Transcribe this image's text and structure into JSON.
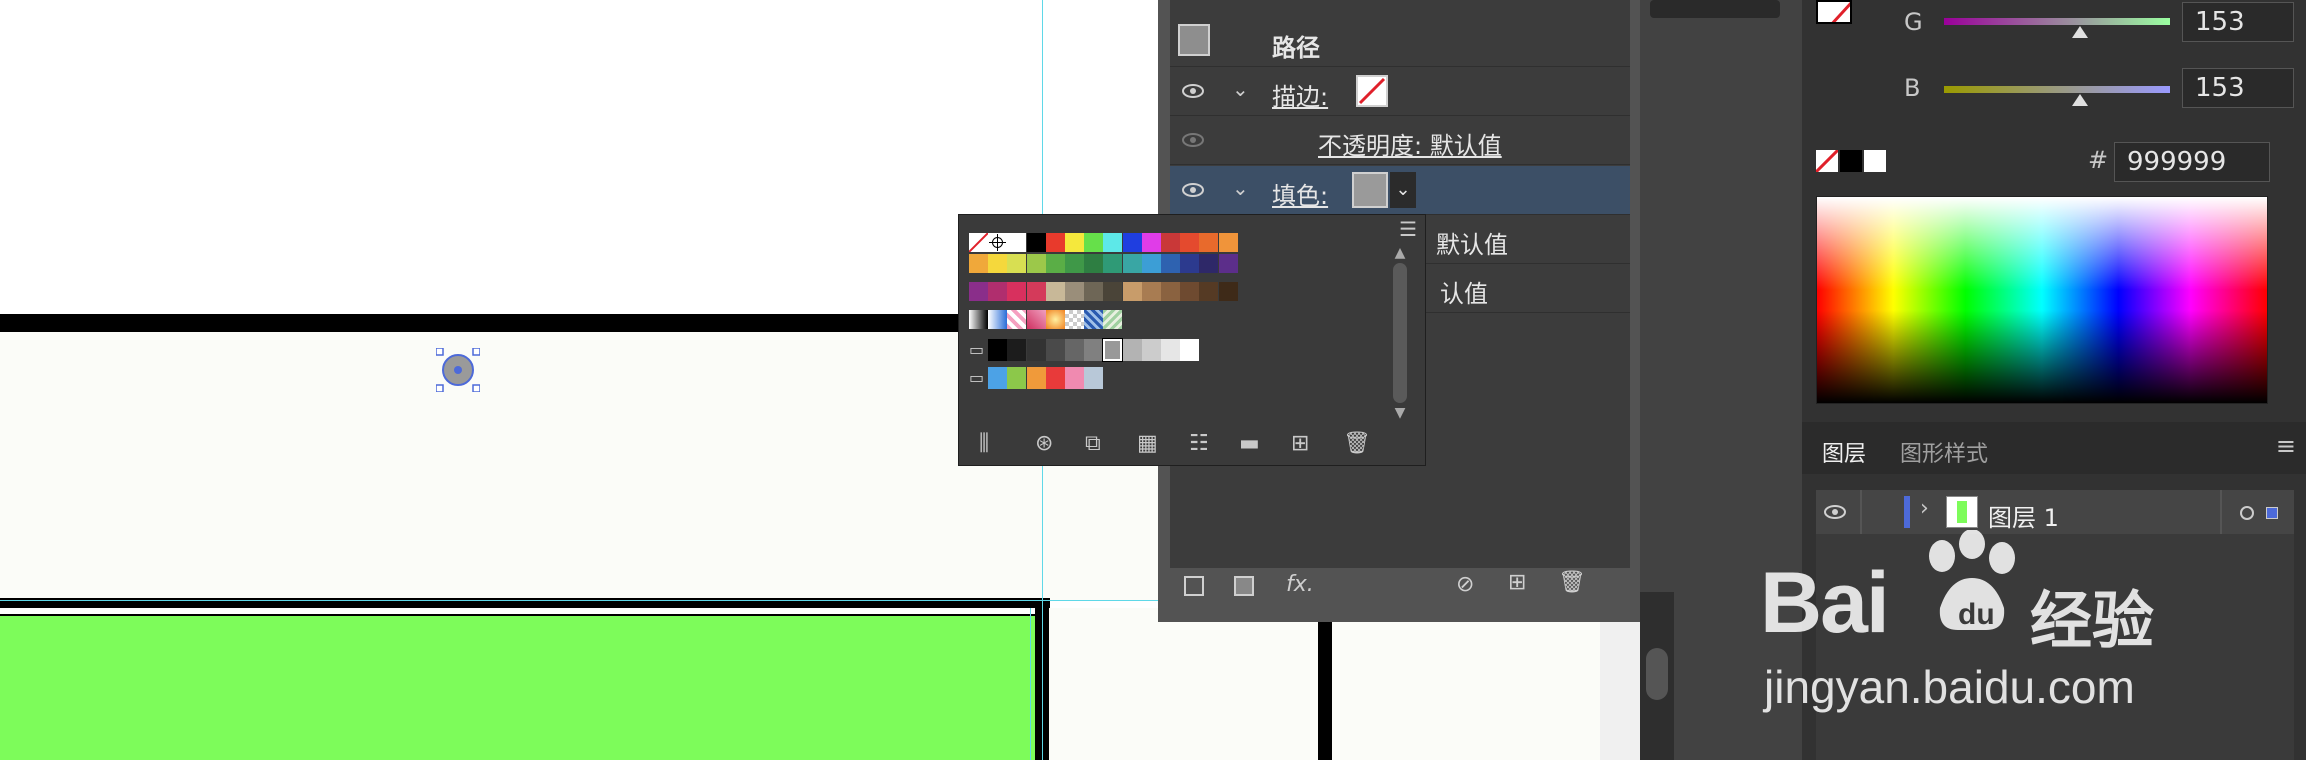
{
  "appearance": {
    "title": "路径",
    "stroke_label": "描边:",
    "stroke_opacity": "不透明度: 默认值",
    "fill_label": "填色:",
    "fill_opacity_partial": "默认值",
    "opacity_partial": "认值",
    "fx_label": "fx."
  },
  "color_panel": {
    "g_label": "G",
    "g_value": "153",
    "b_label": "B",
    "b_value": "153",
    "hex_label": "#",
    "hex_value": "999999",
    "g_level": 0.6,
    "b_level": 0.6
  },
  "layers_panel": {
    "tab_layers": "图层",
    "tab_graphic_styles": "图形样式",
    "layer_name": "图层 1"
  },
  "watermark": {
    "brand_text": "Bai",
    "brand_suffix": "经验",
    "url": "jingyan.baidu.com"
  },
  "colors": {
    "canvas_green": "#7dfc5a",
    "selection_blue": "#4d6ad9",
    "fill_swatch": "#999999"
  }
}
